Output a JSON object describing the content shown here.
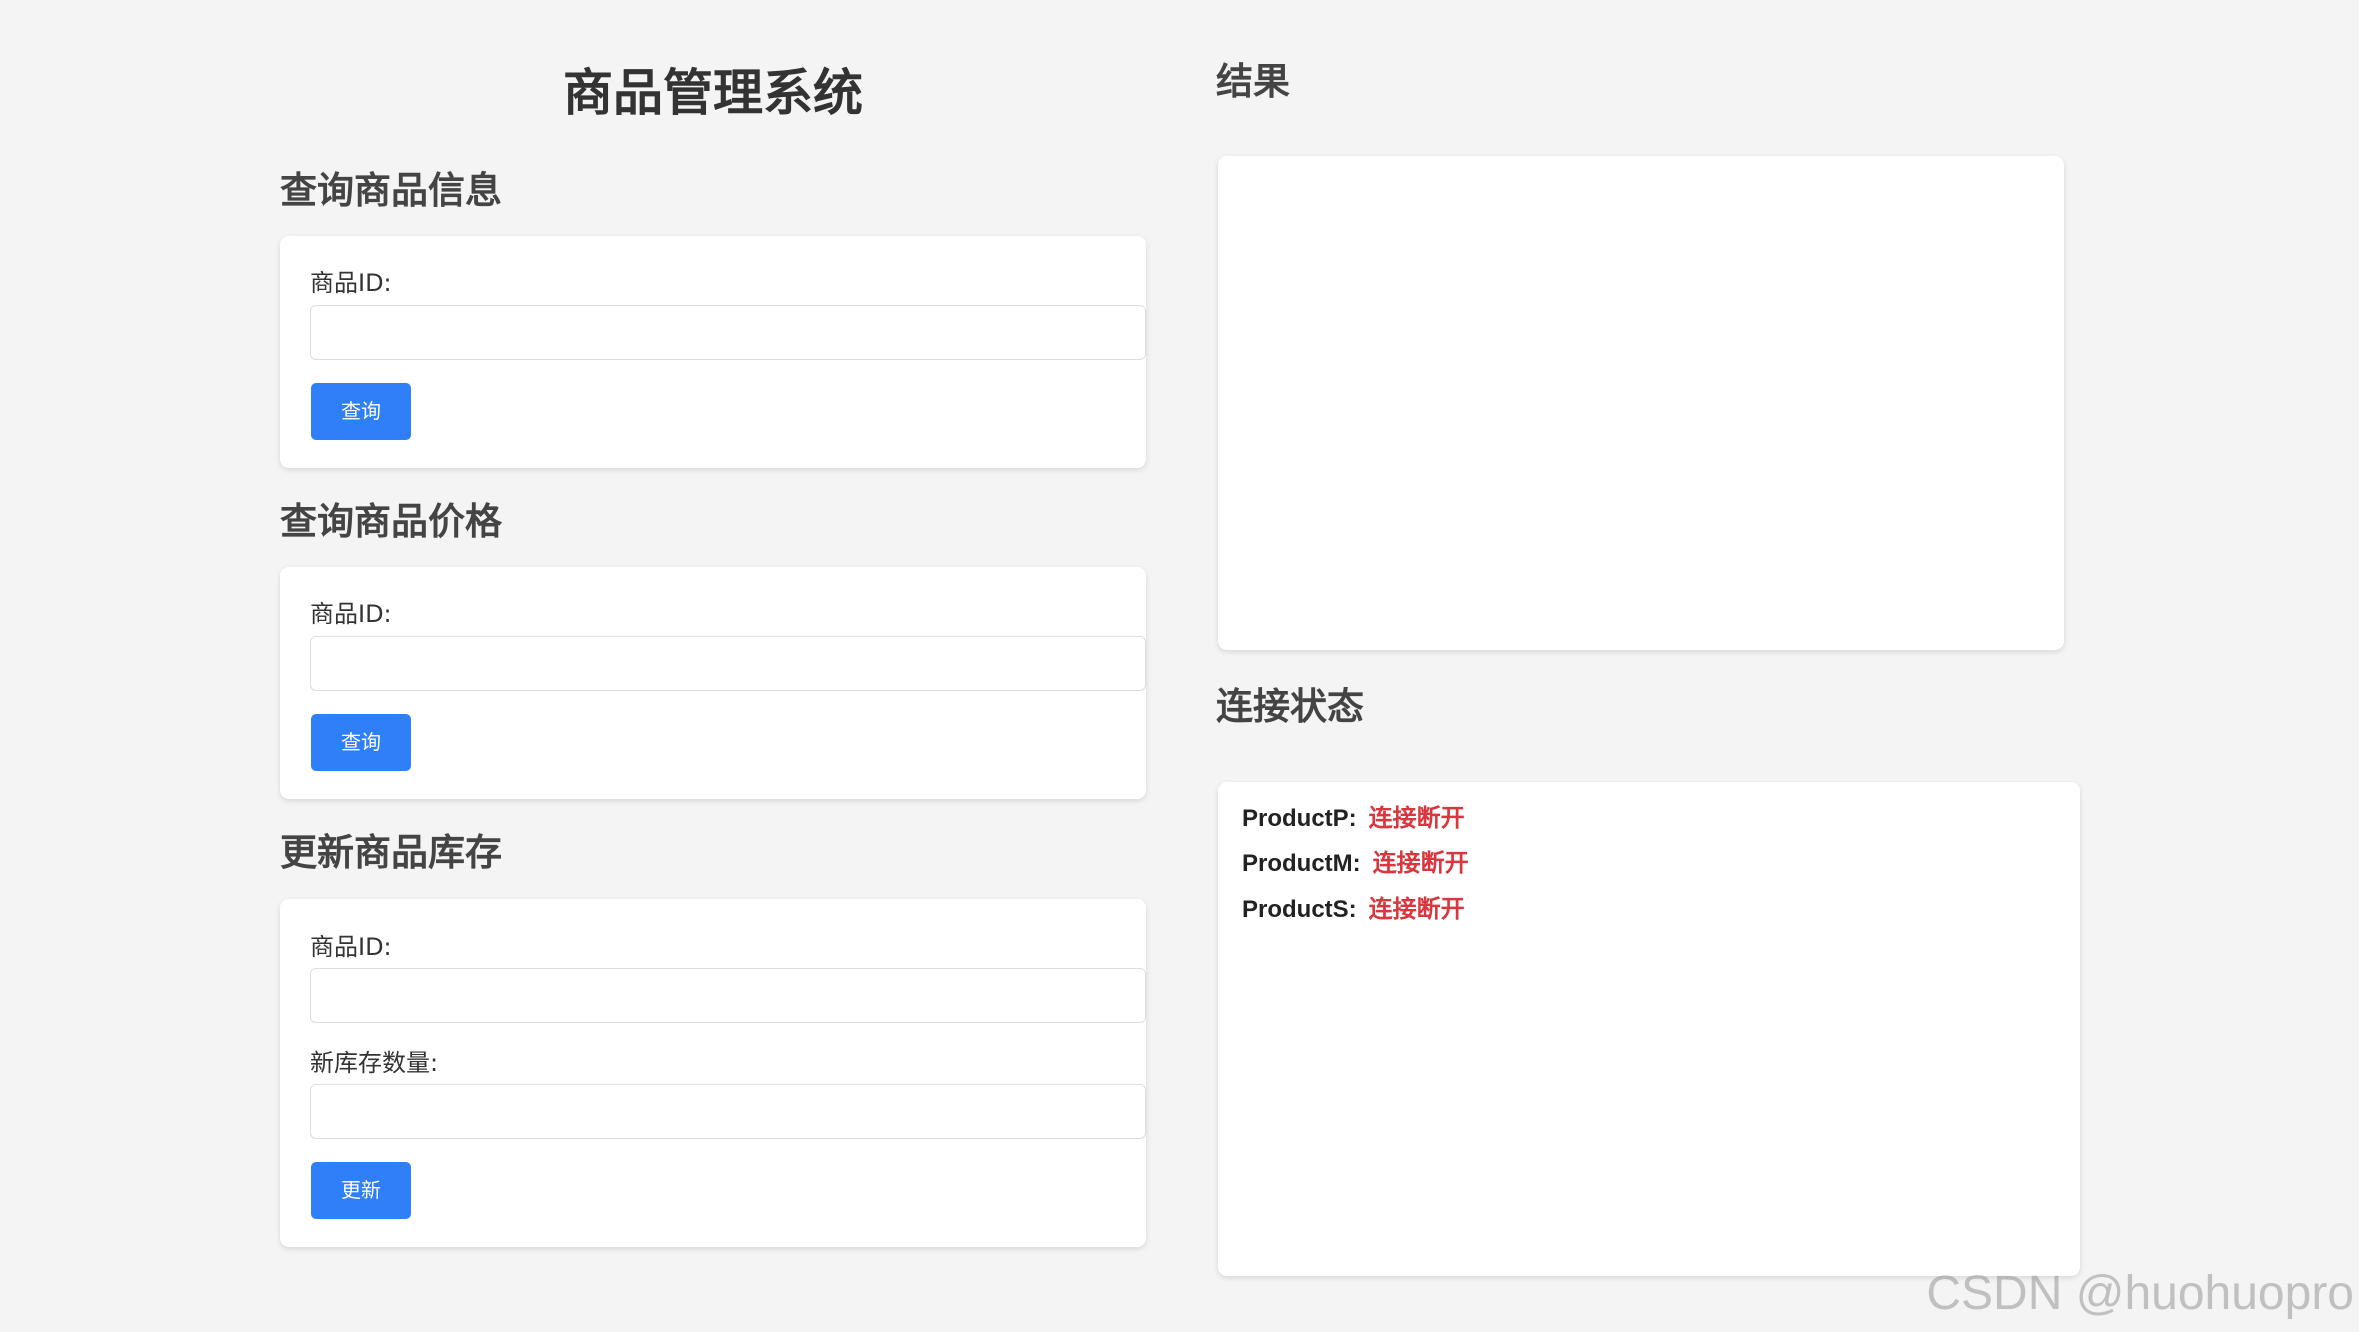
{
  "app": {
    "title": "商品管理系统"
  },
  "query_info": {
    "title": "查询商品信息",
    "id_label": "商品ID:",
    "id_value": "",
    "id_placeholder": "",
    "button_label": "查询"
  },
  "query_price": {
    "title": "查询商品价格",
    "id_label": "商品ID:",
    "id_value": "",
    "id_placeholder": "",
    "button_label": "查询"
  },
  "update_stock": {
    "title": "更新商品库存",
    "id_label": "商品ID:",
    "id_value": "",
    "id_placeholder": "",
    "stock_label": "新库存数量:",
    "stock_value": "",
    "stock_placeholder": "",
    "button_label": "更新"
  },
  "result": {
    "title": "结果",
    "content": ""
  },
  "connection": {
    "title": "连接状态",
    "items": [
      {
        "name": "ProductP:",
        "status": "连接断开"
      },
      {
        "name": "ProductM:",
        "status": "连接断开"
      },
      {
        "name": "ProductS:",
        "status": "连接断开"
      }
    ]
  },
  "colors": {
    "accent": "#2f7ff8",
    "disconnected": "#d9363e",
    "background": "#f4f4f4",
    "card": "#ffffff"
  },
  "watermark": "CSDN @huohuopro"
}
